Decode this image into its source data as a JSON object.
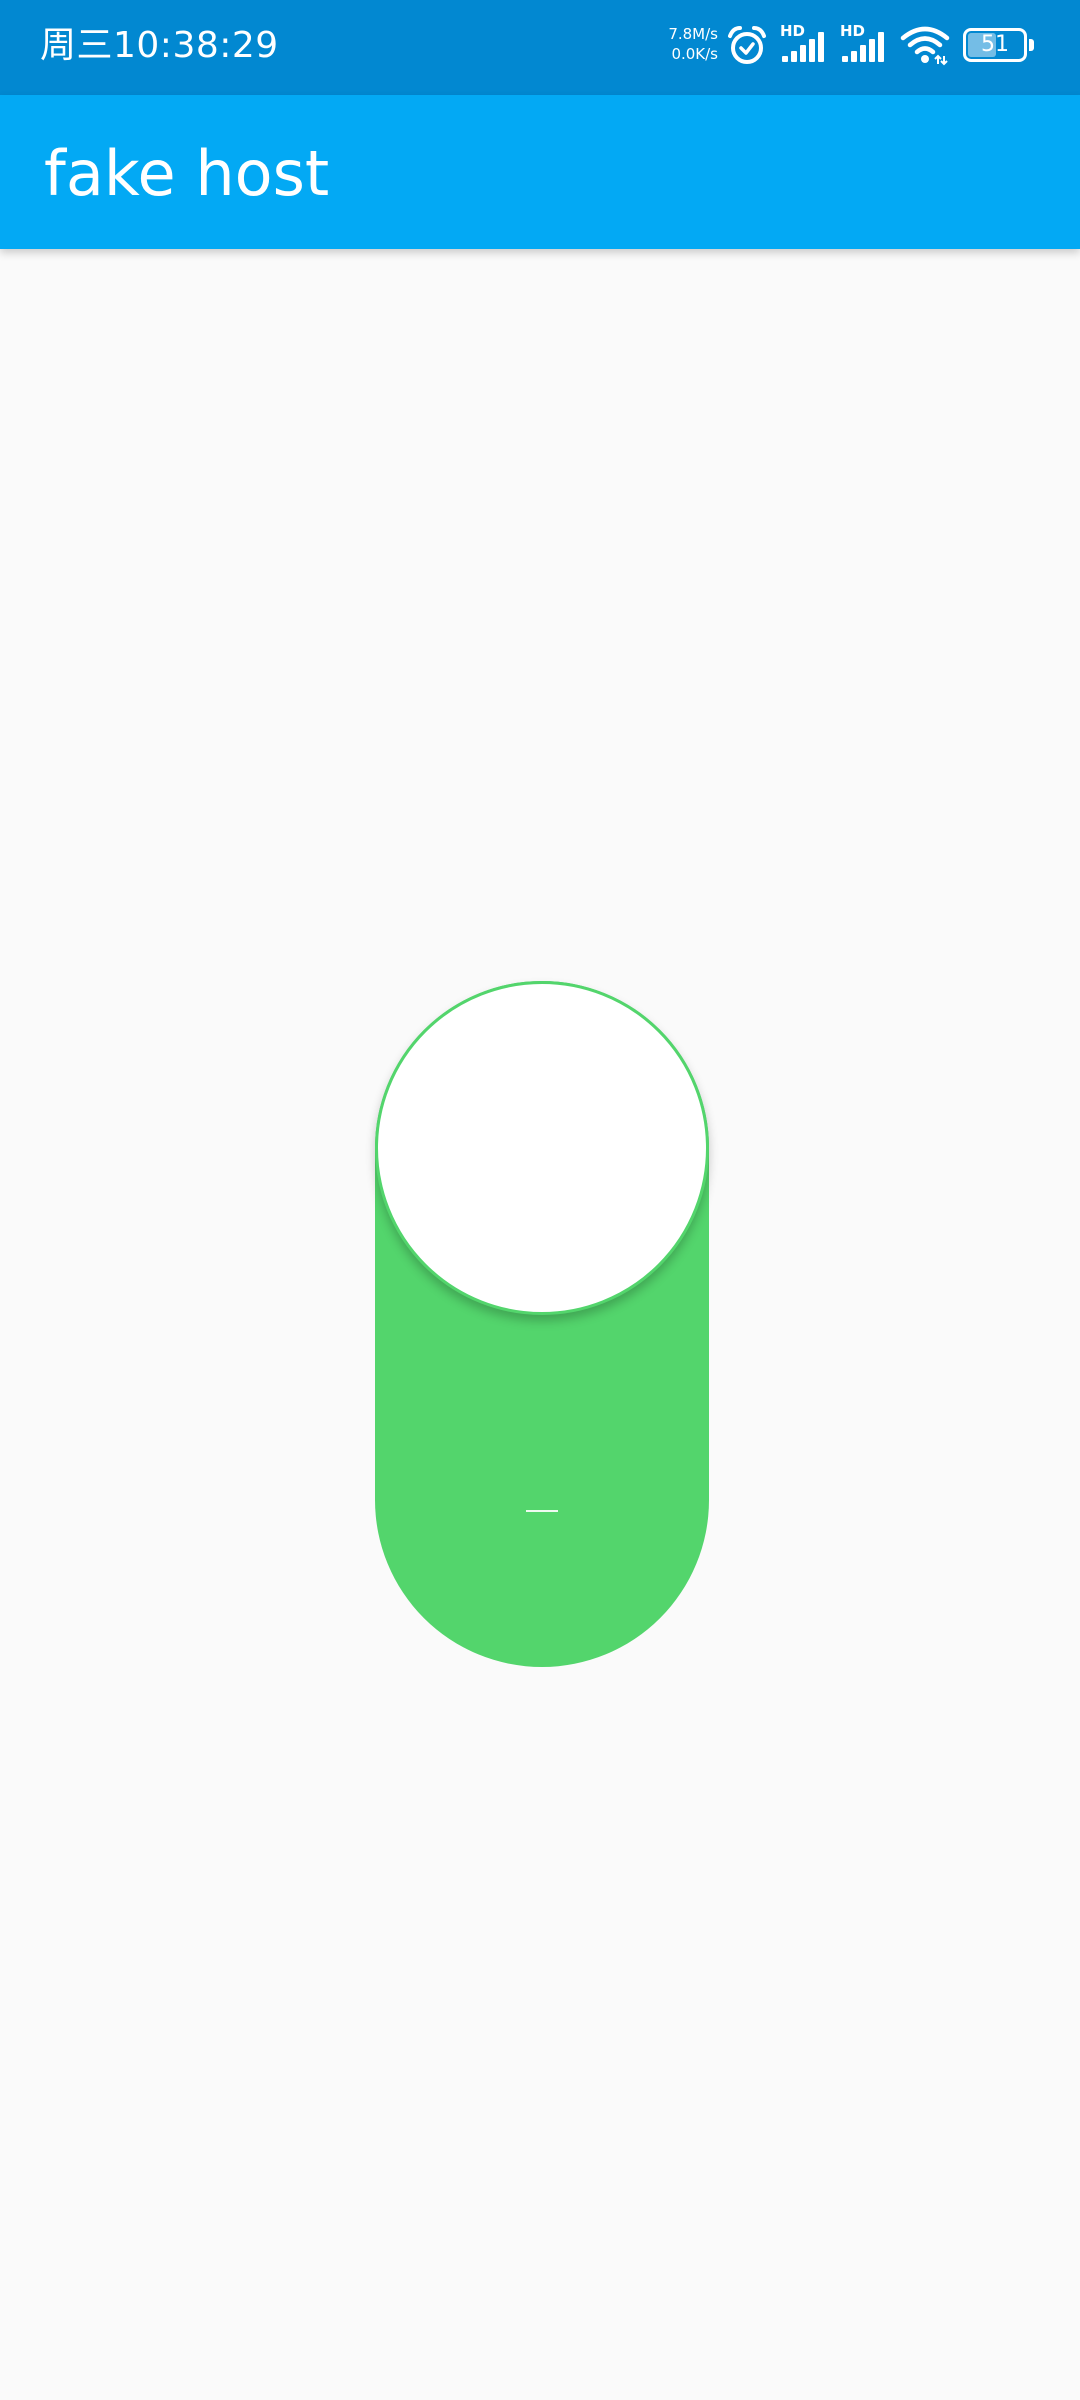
{
  "status_bar": {
    "time": "周三10:38:29",
    "net_up": "7.8M/s",
    "net_down": "0.0K/s",
    "signal_label_1": "HD",
    "signal_label_2": "HD",
    "battery_level": "51",
    "battery_fraction": 0.51,
    "icons": [
      "alarm-icon",
      "signal-icon",
      "signal-icon",
      "wifi-icon",
      "battery-icon"
    ],
    "background_color": "#0288d1"
  },
  "app_bar": {
    "title": "fake host",
    "background_color": "#03a9f4"
  },
  "main": {
    "toggle": {
      "state": "on",
      "on_color": "#53d56c",
      "thumb_color": "#ffffff"
    }
  }
}
